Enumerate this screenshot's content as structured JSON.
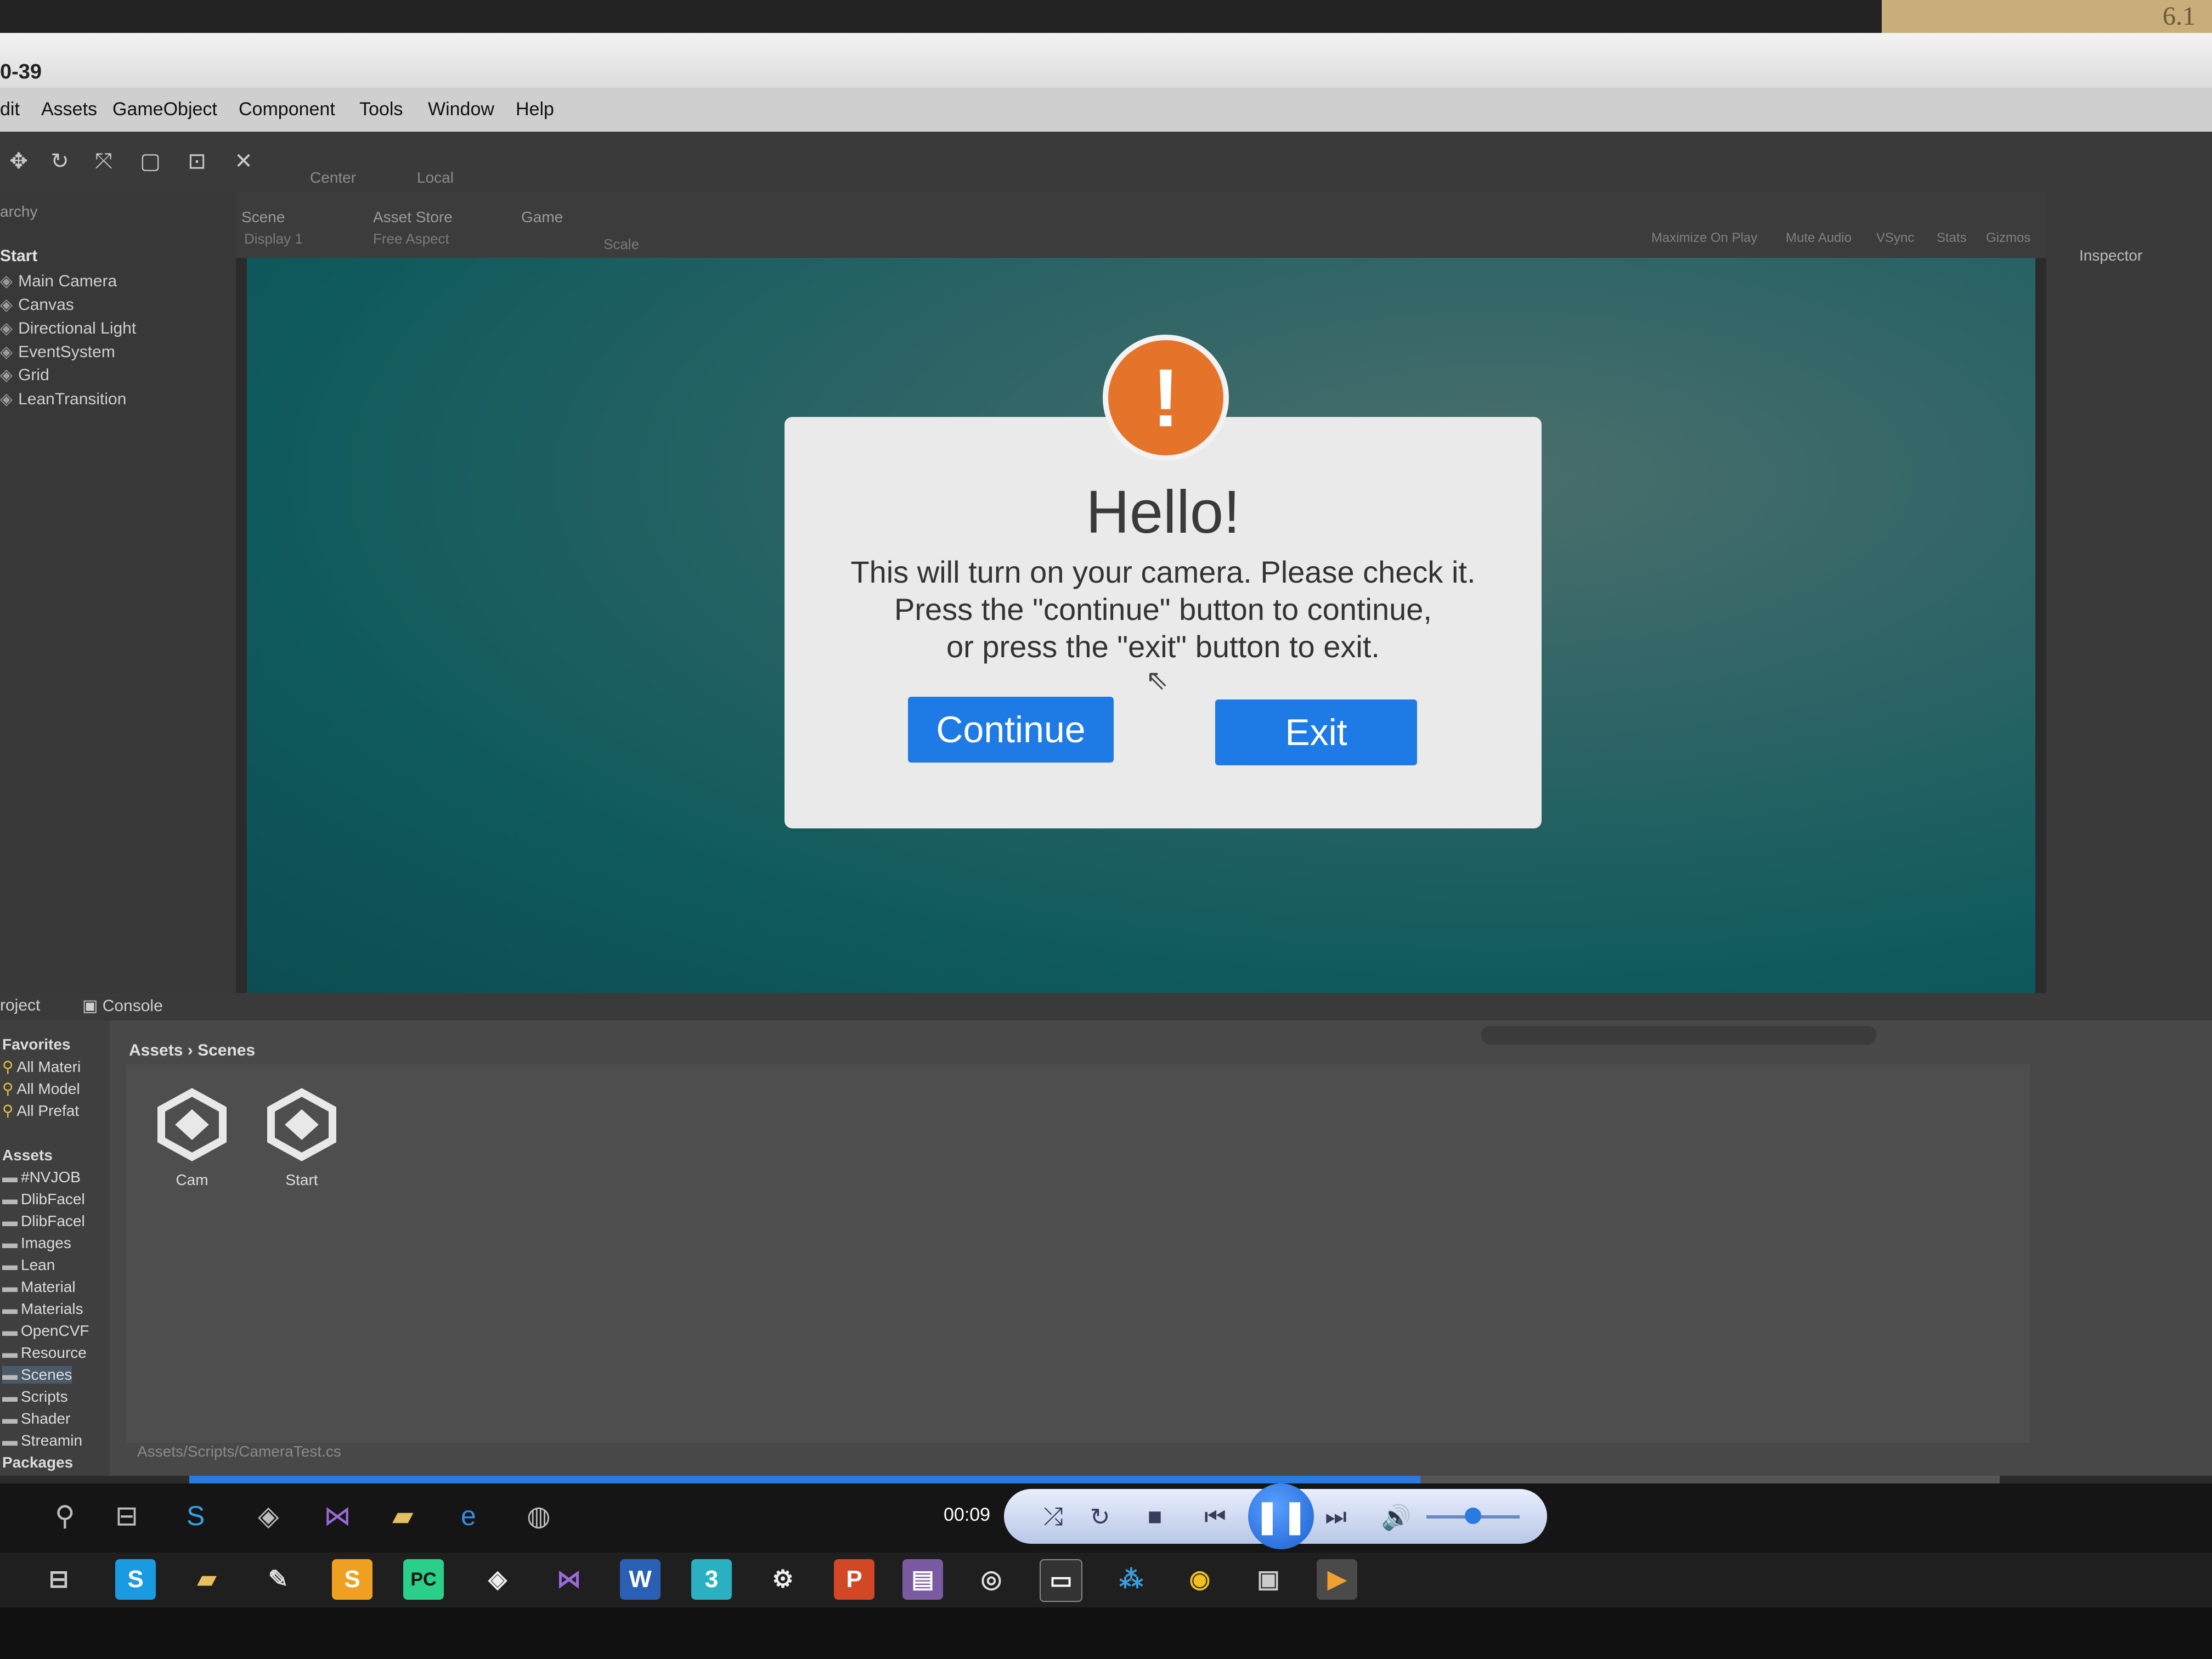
{
  "sticky_note_text": "6.1",
  "window_title": "0-39",
  "menu": [
    "dit",
    "Assets",
    "GameObject",
    "Component",
    "Tools",
    "Window",
    "Help"
  ],
  "toolbar": {
    "pivot": "Center",
    "space": "Local",
    "tabs": [
      "Scene",
      "Asset Store",
      "Game"
    ],
    "display": "Display 1",
    "aspect": "Free Aspect",
    "scale": "Scale",
    "game_options": [
      "Maximize On Play",
      "Mute Audio",
      "VSync",
      "Stats",
      "Gizmos"
    ]
  },
  "hierarchy": {
    "panel": "archy",
    "scene": "Start",
    "items": [
      "Main Camera",
      "Canvas",
      "Directional Light",
      "EventSystem",
      "Grid",
      "LeanTransition"
    ]
  },
  "inspector": {
    "label": "Inspector"
  },
  "dialog": {
    "icon": "!",
    "title": "Hello!",
    "lines": [
      "This will turn on your camera. Please check it.",
      "Press the \"continue\" button to continue,",
      "or press the \"exit\" button to exit."
    ],
    "continue_label": "Continue",
    "exit_label": "Exit"
  },
  "project": {
    "tabs": [
      "roject",
      "Console"
    ],
    "favorites_header": "Favorites",
    "favorites": [
      "All Materi",
      "All Model",
      "All Prefat"
    ],
    "assets_header": "Assets",
    "folders": [
      "#NVJOB",
      "DlibFacel",
      "DlibFacel",
      "Images",
      "Lean",
      "Material",
      "Materials",
      "OpenCVF",
      "Resource",
      "Scenes",
      "Scripts",
      "Shader",
      "Streamin"
    ],
    "packages": "Packages",
    "breadcrumb": [
      "Assets",
      "Scenes"
    ],
    "assets": [
      "Cam",
      "Start"
    ],
    "path": "Assets/Scripts/CameraTest.cs"
  },
  "player": {
    "time": "00:09",
    "progress": 0.68,
    "volume": 0.5
  },
  "colors": {
    "dialog_button": "#1e7be6",
    "alert_icon": "#e6732a",
    "game_bg": "#0f5a5d"
  }
}
